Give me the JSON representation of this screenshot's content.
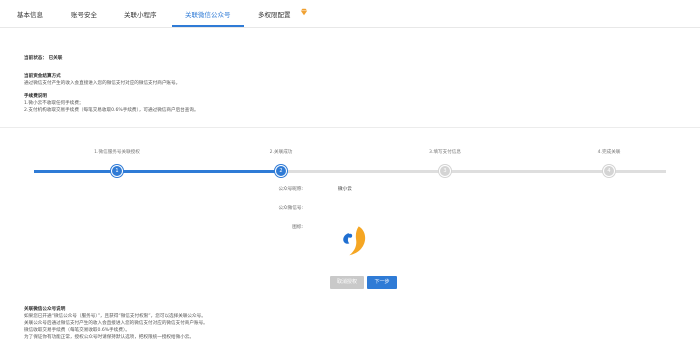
{
  "tabs": [
    {
      "label": "基本信息"
    },
    {
      "label": "账号安全"
    },
    {
      "label": "关联小程序"
    },
    {
      "label": "关联微信公众号"
    },
    {
      "label": "多权限配置"
    }
  ],
  "active_tab": "关联微信公众号",
  "status": {
    "line": "当前状态：  已关联"
  },
  "settlement": {
    "title": "当前资金结算方式",
    "desc": "通过微信支付产生的收入会直接进入您的微信支付对应的微信支付商户账号。",
    "fee_title": "手续费说明",
    "fee_1": "1.微小云不收取任何手续费；",
    "fee_2": "2.支付机构收取交易手续费（每笔交易收取0.6%手续费），可通过微信商户后台查询。"
  },
  "steps": [
    {
      "label": "1.微信服务号关联授权",
      "num": "1",
      "state": "done"
    },
    {
      "label": "2.关联成功",
      "num": "2",
      "state": "done"
    },
    {
      "label": "3.填写支付信息",
      "num": "3",
      "state": "todo"
    },
    {
      "label": "4.完成关联",
      "num": "4",
      "state": "todo"
    }
  ],
  "account": {
    "name_label": "公众号昵称:",
    "name_value": "微小云",
    "wechat_label": "公众微信号:",
    "wechat_value": "",
    "icon_label": "图标:"
  },
  "buttons": {
    "cancel": "取消授权",
    "next": "下一步"
  },
  "notes": {
    "title": "关联微信公众号说明",
    "line1": "如果您已开通“微信公众号（服务号）”，且获得“微信支付权限”，您可以选择关联公众号。",
    "line2": "关联公众号后通过微信支付产生的收入会直接进入您的微信支付对应的微信支付商户账号。",
    "line3": "微信收取交易手续费（每笔交易收取0.6%手续费）。",
    "line4": "为了保证你有功能正常，授权公众号时请保持默认选项，把权限统一授权给微小云。"
  },
  "colors": {
    "accent": "#2f7bd6",
    "logo_blue": "#1f6fd1",
    "logo_orange": "#f5a623",
    "badge": "#f0a030"
  }
}
